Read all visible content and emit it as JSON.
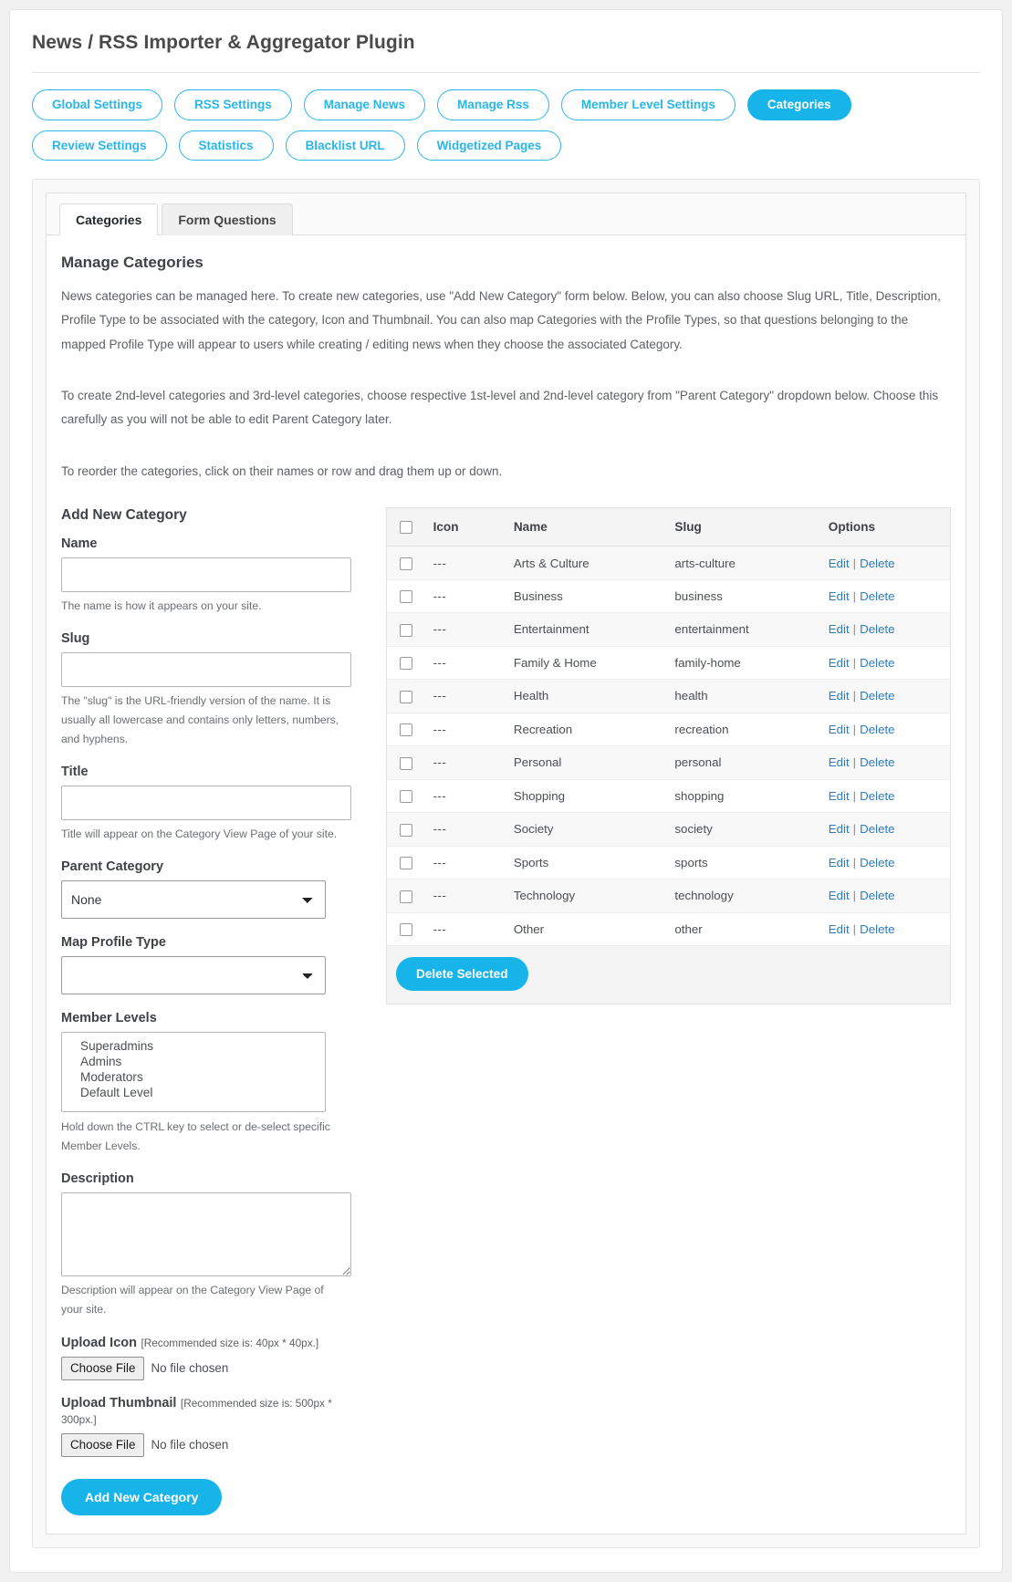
{
  "header": {
    "plugin_title": "News / RSS Importer & Aggregator Plugin"
  },
  "nav_pills": [
    {
      "label": "Global Settings",
      "active": false
    },
    {
      "label": "RSS Settings",
      "active": false
    },
    {
      "label": "Manage News",
      "active": false
    },
    {
      "label": "Manage Rss",
      "active": false
    },
    {
      "label": "Member Level Settings",
      "active": false
    },
    {
      "label": "Categories",
      "active": true
    },
    {
      "label": "Review Settings",
      "active": false
    },
    {
      "label": "Statistics",
      "active": false
    },
    {
      "label": "Blacklist URL",
      "active": false
    },
    {
      "label": "Widgetized Pages",
      "active": false
    }
  ],
  "tabs": [
    {
      "label": "Categories",
      "active": true
    },
    {
      "label": "Form Questions",
      "active": false
    }
  ],
  "main": {
    "section_title": "Manage Categories",
    "intro_1": "News categories can be managed here. To create new categories, use \"Add New Category\" form below. Below, you can also choose Slug URL, Title, Description, Profile Type to be associated with the category, Icon and Thumbnail. You can also map Categories with the Profile Types, so that questions belonging to the mapped Profile Type will appear to users while creating / editing news when they choose the associated Category.",
    "intro_2": "To create 2nd-level categories and 3rd-level categories, choose respective 1st-level and 2nd-level category from \"Parent Category\" dropdown below. Choose this carefully as you will not be able to edit Parent Category later.",
    "intro_3": "To reorder the categories, click on their names or row and drag them up or down."
  },
  "form": {
    "heading": "Add New Category",
    "name_label": "Name",
    "name_value": "",
    "name_help": "The name is how it appears on your site.",
    "slug_label": "Slug",
    "slug_value": "",
    "slug_help": "The \"slug\" is the URL-friendly version of the name. It is usually all lowercase and contains only letters, numbers, and hyphens.",
    "title_label": "Title",
    "title_value": "",
    "title_help": "Title will appear on the Category View Page of your site.",
    "parent_label": "Parent Category",
    "parent_selected": "None",
    "parent_options": [
      "None"
    ],
    "map_profile_label": "Map Profile Type",
    "map_profile_selected": "",
    "map_profile_options": [
      ""
    ],
    "member_levels_label": "Member Levels",
    "member_levels": [
      "Superadmins",
      "Admins",
      "Moderators",
      "Default Level"
    ],
    "member_levels_help": "Hold down the CTRL key to select or de-select specific Member Levels.",
    "description_label": "Description",
    "description_value": "",
    "description_help": "Description will appear on the Category View Page of your site.",
    "upload_icon_label": "Upload Icon",
    "upload_icon_hint": "[Recommended size is: 40px * 40px.]",
    "upload_thumbnail_label": "Upload Thumbnail",
    "upload_thumbnail_hint": "[Recommended size is: 500px * 300px.]",
    "choose_file_label": "Choose File",
    "no_file_chosen_label": "No file chosen",
    "submit_label": "Add New Category"
  },
  "table": {
    "columns": [
      "",
      "Icon",
      "Name",
      "Slug",
      "Options"
    ],
    "edit_label": "Edit",
    "delete_label": "Delete",
    "separator": "|",
    "icon_placeholder": "---",
    "rows": [
      {
        "icon": "---",
        "name": "Arts & Culture",
        "slug": "arts-culture"
      },
      {
        "icon": "---",
        "name": "Business",
        "slug": "business"
      },
      {
        "icon": "---",
        "name": "Entertainment",
        "slug": "entertainment"
      },
      {
        "icon": "---",
        "name": "Family & Home",
        "slug": "family-home"
      },
      {
        "icon": "---",
        "name": "Health",
        "slug": "health"
      },
      {
        "icon": "---",
        "name": "Recreation",
        "slug": "recreation"
      },
      {
        "icon": "---",
        "name": "Personal",
        "slug": "personal"
      },
      {
        "icon": "---",
        "name": "Shopping",
        "slug": "shopping"
      },
      {
        "icon": "---",
        "name": "Society",
        "slug": "society"
      },
      {
        "icon": "---",
        "name": "Sports",
        "slug": "sports"
      },
      {
        "icon": "---",
        "name": "Technology",
        "slug": "technology"
      },
      {
        "icon": "---",
        "name": "Other",
        "slug": "other"
      }
    ],
    "delete_selected_label": "Delete Selected"
  },
  "colors": {
    "accent": "#17b4ea",
    "accent_outline": "#29b6ea",
    "link": "#2f7bbf",
    "text": "#4b4f53"
  }
}
